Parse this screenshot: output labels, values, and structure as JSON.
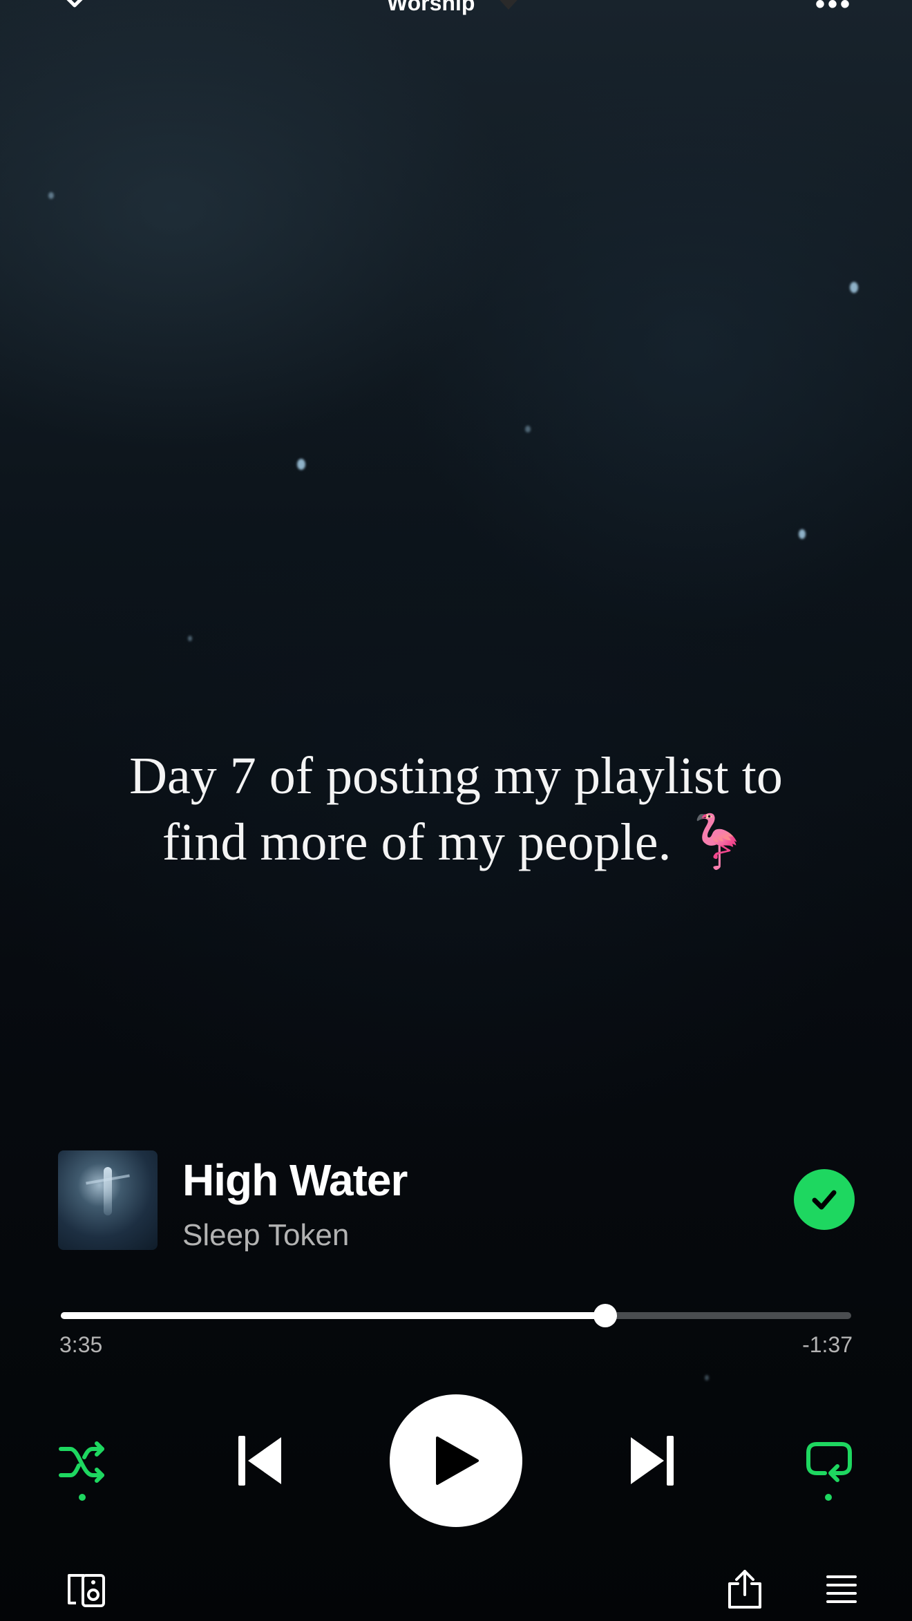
{
  "header": {
    "title": "Worship",
    "icons": [
      "chevron-down-icon",
      "heart-icon",
      "more-options-icon"
    ]
  },
  "caption": {
    "line1": "Day 7 of posting my playlist to",
    "line2": "find more of my people. 🦩"
  },
  "track": {
    "title": "High Water",
    "artist": "Sleep Token",
    "liked": true
  },
  "playback": {
    "elapsed": "3:35",
    "remaining": "-1:37",
    "progress_fraction": 0.689,
    "shuffle_on": true,
    "repeat_on": true
  },
  "colors": {
    "accent": "#1ed760",
    "background": "#070b0f",
    "secondary_text": "#b3b3b3"
  },
  "footer_icons": [
    "connect-device-icon",
    "share-icon",
    "queue-icon"
  ]
}
